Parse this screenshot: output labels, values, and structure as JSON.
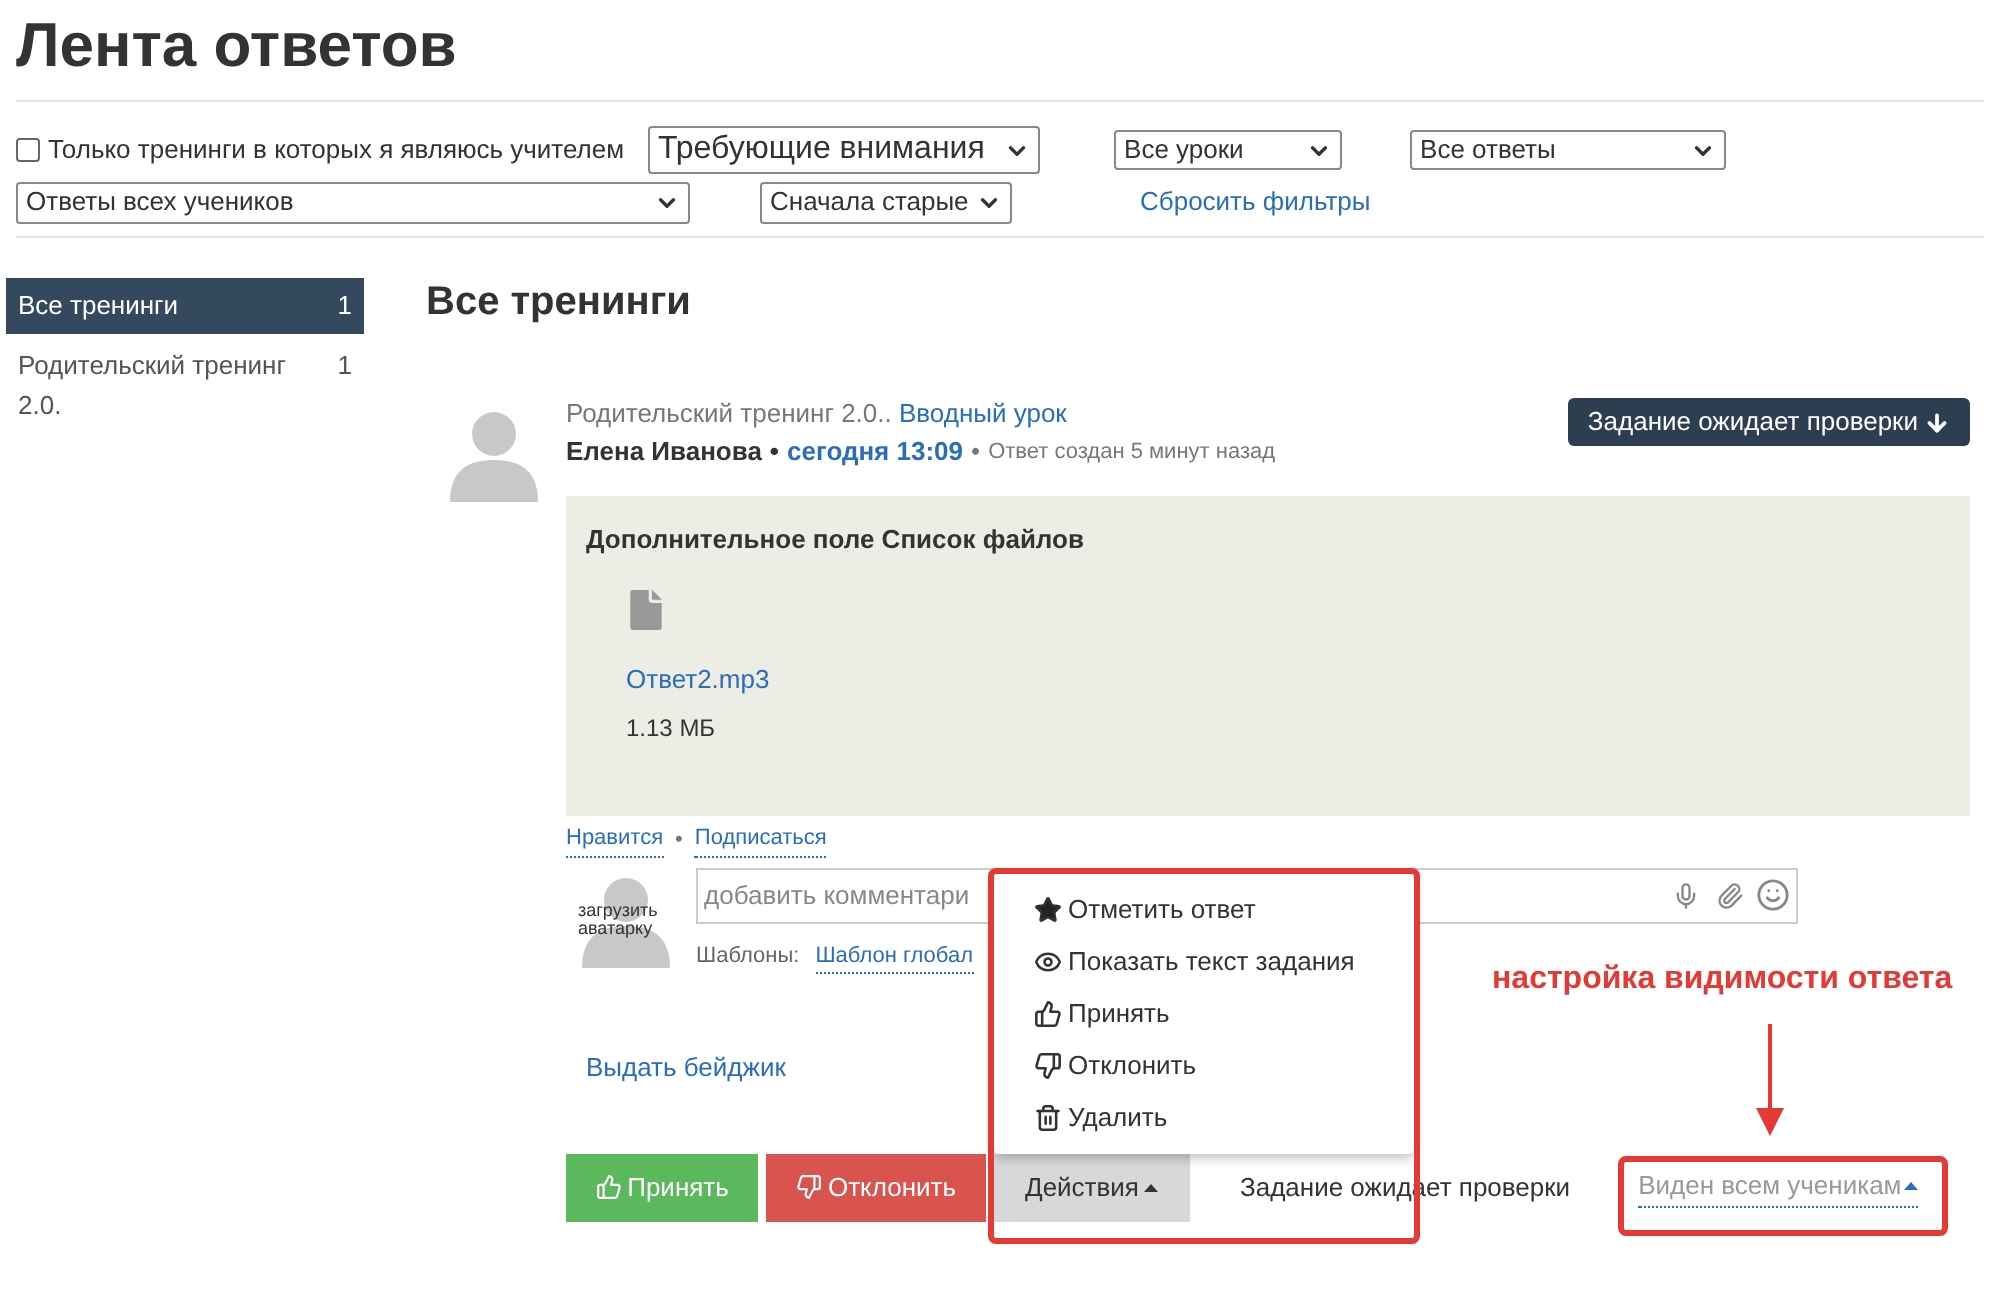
{
  "page_title": "Лента ответов",
  "filters": {
    "teacher_only": {
      "label": "Только тренинги в которых я являюсь учителем",
      "checked": false
    },
    "selects": [
      {
        "value": "Требующие внимания"
      },
      {
        "value": "Все уроки"
      },
      {
        "value": "Все ответы"
      },
      {
        "value": "Ответы всех учеников"
      },
      {
        "value": "Сначала старые"
      }
    ],
    "reset_link": "Сбросить фильтры"
  },
  "sidebar": {
    "items": [
      {
        "label": "Все тренинги",
        "count": "1",
        "selected": true
      },
      {
        "label": "Родительский тренинг 2.0.",
        "count": "1",
        "selected": false
      }
    ]
  },
  "section_title": "Все тренинги",
  "post": {
    "course": "Родительский тренинг 2.0..",
    "lesson": "Вводный урок",
    "author": "Елена Иванова",
    "time": "сегодня 13:09",
    "meta": "Ответ создан 5 минут назад",
    "separators": [
      "•",
      "•",
      "•"
    ],
    "status_button": "Задание ожидает проверки",
    "attachment": {
      "title": "Дополнительное поле Список файлов",
      "file_name": "Ответ2.mp3",
      "file_size": "1.13 МБ"
    },
    "links": [
      "Нравится",
      "Подписаться"
    ],
    "comment": {
      "avatar_label": "загрузить аватарку",
      "placeholder": "добавить комментари",
      "templates_label": "Шаблоны:",
      "template_link": "Шаблон глобал"
    },
    "badge_link": "Выдать бейджик",
    "accept_button": "Принять",
    "reject_button": "Отклонить",
    "actions": {
      "label": "Действия",
      "open": true,
      "items": [
        {
          "kind": "star",
          "label": "Отметить ответ"
        },
        {
          "kind": "eye",
          "label": "Показать текст задания"
        },
        {
          "kind": "like",
          "label": "Принять"
        },
        {
          "kind": "dislike",
          "label": "Отклонить"
        },
        {
          "kind": "trash",
          "label": "Удалить"
        }
      ]
    },
    "status_text": "Задание ожидает проверки",
    "visibility": "Виден всем ученикам"
  },
  "annotation": "настройка видимости ответа"
}
